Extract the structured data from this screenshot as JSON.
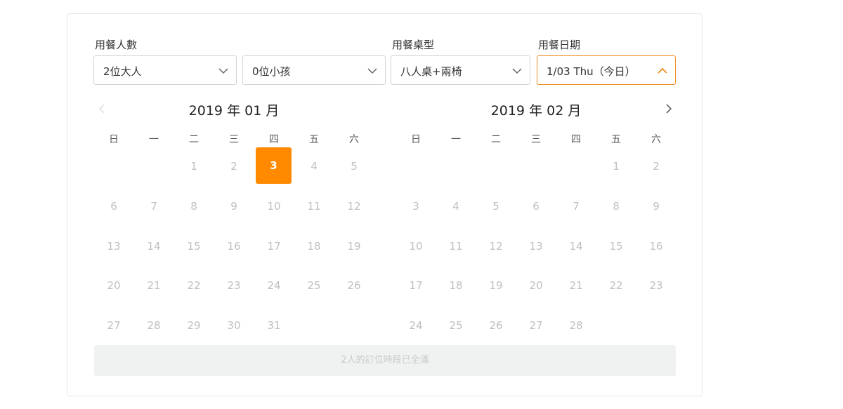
{
  "form": {
    "party_label": "用餐人數",
    "table_label": "用餐桌型",
    "date_label": "用餐日期",
    "adults_value": "2位大人",
    "children_value": "0位小孩",
    "table_value": "八人桌+兩椅",
    "date_value": "1/03 Thu（今日）"
  },
  "calendar": {
    "weekdays": [
      "日",
      "一",
      "二",
      "三",
      "四",
      "五",
      "六"
    ],
    "months": [
      {
        "title": "2019 年 01 月",
        "weeks": [
          [
            "",
            "",
            "1",
            "2",
            "3",
            "4",
            "5"
          ],
          [
            "6",
            "7",
            "8",
            "9",
            "10",
            "11",
            "12"
          ],
          [
            "13",
            "14",
            "15",
            "16",
            "17",
            "18",
            "19"
          ],
          [
            "20",
            "21",
            "22",
            "23",
            "24",
            "25",
            "26"
          ],
          [
            "27",
            "28",
            "29",
            "30",
            "31",
            "",
            ""
          ]
        ],
        "selected": "3"
      },
      {
        "title": "2019 年 02 月",
        "weeks": [
          [
            "",
            "",
            "",
            "",
            "",
            "1",
            "2"
          ],
          [
            "3",
            "4",
            "5",
            "6",
            "7",
            "8",
            "9"
          ],
          [
            "10",
            "11",
            "12",
            "13",
            "14",
            "15",
            "16"
          ],
          [
            "17",
            "18",
            "19",
            "20",
            "21",
            "22",
            "23"
          ],
          [
            "24",
            "25",
            "26",
            "27",
            "28",
            "",
            ""
          ]
        ],
        "selected": ""
      }
    ]
  },
  "status": {
    "full_message": "2人的訂位時段已全滿"
  },
  "colors": {
    "accent": "#ff8a00",
    "border_active": "#f08a1c",
    "disabled_text": "#bfbfbf",
    "banner_bg": "#f0f2f2"
  },
  "icons": {
    "select_closed": "chevron-down-icon",
    "select_open": "chevron-up-icon",
    "prev": "chevron-left-icon",
    "next": "chevron-right-icon"
  }
}
